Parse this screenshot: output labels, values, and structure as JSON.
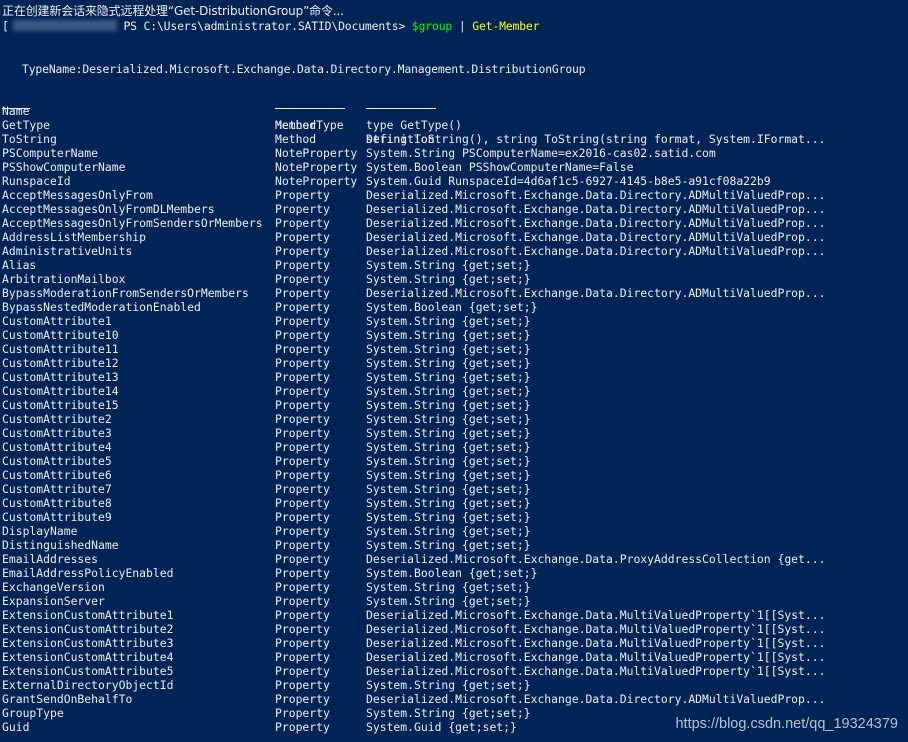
{
  "console": {
    "status_line": "正在创建新会话来隐式远程处理“Get-DistributionGroup”命令...",
    "prompt_prefix": "[",
    "prompt_path": "PS C:\\Users\\administrator.SATID\\Documents>",
    "prompt_variable": "$group",
    "prompt_pipe": " | ",
    "prompt_command": "Get-Member",
    "type_name_line": "TypeName:Deserialized.Microsoft.Exchange.Data.Directory.Management.DistributionGroup",
    "headers": {
      "name": "Name",
      "member_type": "MemberType",
      "definition": "Definition"
    },
    "rows": [
      {
        "name": "GetType",
        "type": "Method",
        "def": "type GetType()"
      },
      {
        "name": "ToString",
        "type": "Method",
        "def": "string ToString(), string ToString(string format, System.IFormat..."
      },
      {
        "name": "PSComputerName",
        "type": "NoteProperty",
        "def": "System.String PSComputerName=ex2016-cas02.satid.com"
      },
      {
        "name": "PSShowComputerName",
        "type": "NoteProperty",
        "def": "System.Boolean PSShowComputerName=False"
      },
      {
        "name": "RunspaceId",
        "type": "NoteProperty",
        "def": "System.Guid RunspaceId=4d6af1c5-6927-4145-b8e5-a91cf08a22b9"
      },
      {
        "name": "AcceptMessagesOnlyFrom",
        "type": "Property",
        "def": "Deserialized.Microsoft.Exchange.Data.Directory.ADMultiValuedProp..."
      },
      {
        "name": "AcceptMessagesOnlyFromDLMembers",
        "type": "Property",
        "def": "Deserialized.Microsoft.Exchange.Data.Directory.ADMultiValuedProp..."
      },
      {
        "name": "AcceptMessagesOnlyFromSendersOrMembers",
        "type": "Property",
        "def": "Deserialized.Microsoft.Exchange.Data.Directory.ADMultiValuedProp..."
      },
      {
        "name": "AddressListMembership",
        "type": "Property",
        "def": "Deserialized.Microsoft.Exchange.Data.Directory.ADMultiValuedProp..."
      },
      {
        "name": "AdministrativeUnits",
        "type": "Property",
        "def": "Deserialized.Microsoft.Exchange.Data.Directory.ADMultiValuedProp..."
      },
      {
        "name": "Alias",
        "type": "Property",
        "def": "System.String {get;set;}"
      },
      {
        "name": "ArbitrationMailbox",
        "type": "Property",
        "def": "System.String {get;set;}"
      },
      {
        "name": "BypassModerationFromSendersOrMembers",
        "type": "Property",
        "def": "Deserialized.Microsoft.Exchange.Data.Directory.ADMultiValuedProp..."
      },
      {
        "name": "BypassNestedModerationEnabled",
        "type": "Property",
        "def": "System.Boolean {get;set;}"
      },
      {
        "name": "CustomAttribute1",
        "type": "Property",
        "def": "System.String {get;set;}"
      },
      {
        "name": "CustomAttribute10",
        "type": "Property",
        "def": "System.String {get;set;}"
      },
      {
        "name": "CustomAttribute11",
        "type": "Property",
        "def": "System.String {get;set;}"
      },
      {
        "name": "CustomAttribute12",
        "type": "Property",
        "def": "System.String {get;set;}"
      },
      {
        "name": "CustomAttribute13",
        "type": "Property",
        "def": "System.String {get;set;}"
      },
      {
        "name": "CustomAttribute14",
        "type": "Property",
        "def": "System.String {get;set;}"
      },
      {
        "name": "CustomAttribute15",
        "type": "Property",
        "def": "System.String {get;set;}"
      },
      {
        "name": "CustomAttribute2",
        "type": "Property",
        "def": "System.String {get;set;}"
      },
      {
        "name": "CustomAttribute3",
        "type": "Property",
        "def": "System.String {get;set;}"
      },
      {
        "name": "CustomAttribute4",
        "type": "Property",
        "def": "System.String {get;set;}"
      },
      {
        "name": "CustomAttribute5",
        "type": "Property",
        "def": "System.String {get;set;}"
      },
      {
        "name": "CustomAttribute6",
        "type": "Property",
        "def": "System.String {get;set;}"
      },
      {
        "name": "CustomAttribute7",
        "type": "Property",
        "def": "System.String {get;set;}"
      },
      {
        "name": "CustomAttribute8",
        "type": "Property",
        "def": "System.String {get;set;}"
      },
      {
        "name": "CustomAttribute9",
        "type": "Property",
        "def": "System.String {get;set;}"
      },
      {
        "name": "DisplayName",
        "type": "Property",
        "def": "System.String {get;set;}"
      },
      {
        "name": "DistinguishedName",
        "type": "Property",
        "def": "System.String {get;set;}"
      },
      {
        "name": "EmailAddresses",
        "type": "Property",
        "def": "Deserialized.Microsoft.Exchange.Data.ProxyAddressCollection {get..."
      },
      {
        "name": "EmailAddressPolicyEnabled",
        "type": "Property",
        "def": "System.Boolean {get;set;}"
      },
      {
        "name": "ExchangeVersion",
        "type": "Property",
        "def": "System.String {get;set;}"
      },
      {
        "name": "ExpansionServer",
        "type": "Property",
        "def": "System.String {get;set;}"
      },
      {
        "name": "ExtensionCustomAttribute1",
        "type": "Property",
        "def": "Deserialized.Microsoft.Exchange.Data.MultiValuedProperty`1[[Syst..."
      },
      {
        "name": "ExtensionCustomAttribute2",
        "type": "Property",
        "def": "Deserialized.Microsoft.Exchange.Data.MultiValuedProperty`1[[Syst..."
      },
      {
        "name": "ExtensionCustomAttribute3",
        "type": "Property",
        "def": "Deserialized.Microsoft.Exchange.Data.MultiValuedProperty`1[[Syst..."
      },
      {
        "name": "ExtensionCustomAttribute4",
        "type": "Property",
        "def": "Deserialized.Microsoft.Exchange.Data.MultiValuedProperty`1[[Syst..."
      },
      {
        "name": "ExtensionCustomAttribute5",
        "type": "Property",
        "def": "Deserialized.Microsoft.Exchange.Data.MultiValuedProperty`1[[Syst..."
      },
      {
        "name": "ExternalDirectoryObjectId",
        "type": "Property",
        "def": "System.String {get;set;}"
      },
      {
        "name": "GrantSendOnBehalfTo",
        "type": "Property",
        "def": "Deserialized.Microsoft.Exchange.Data.Directory.ADMultiValuedProp..."
      },
      {
        "name": "GroupType",
        "type": "Property",
        "def": "System.String {get;set;}"
      },
      {
        "name": "Guid",
        "type": "Property",
        "def": "System.Guid {get;set;}"
      }
    ]
  },
  "watermark": "https://blog.csdn.net/qq_19324379",
  "colors": {
    "background": "#012456",
    "foreground": "#eeedf0",
    "variable": "#00ff00",
    "command": "#ffff00"
  }
}
